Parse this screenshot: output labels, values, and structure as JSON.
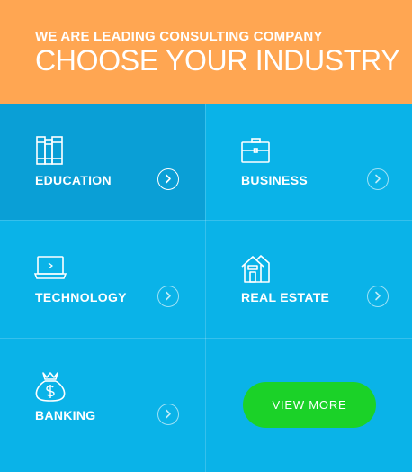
{
  "header": {
    "eyebrow": "WE ARE LEADING CONSULTING COMPANY",
    "title": "CHOOSE YOUR INDUSTRY",
    "background_color": "#ffa652"
  },
  "industries": [
    {
      "label": "EDUCATION",
      "icon": "books-icon",
      "active": true
    },
    {
      "label": "BUSINESS",
      "icon": "briefcase-icon",
      "active": false
    },
    {
      "label": "TECHNOLOGY",
      "icon": "laptop-icon",
      "active": false
    },
    {
      "label": "REAL ESTATE",
      "icon": "houses-icon",
      "active": false
    },
    {
      "label": "BANKING",
      "icon": "money-bag-icon",
      "active": false
    }
  ],
  "view_more": {
    "label": "VIEW MORE",
    "color": "#1bd228"
  },
  "colors": {
    "tile_background": "#0ab3e8",
    "active_tile_background": "#0a9fd6"
  }
}
